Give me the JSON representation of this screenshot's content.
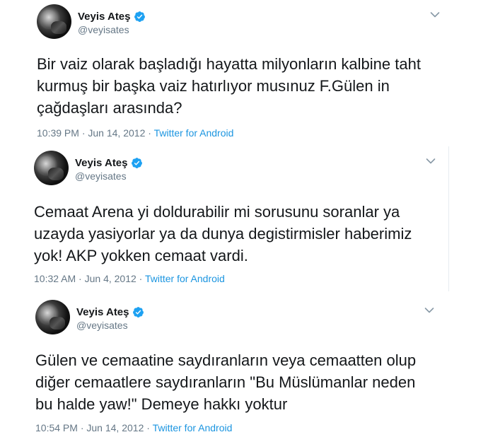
{
  "colors": {
    "verified": "#1da1f2",
    "link": "#1b95e0",
    "muted": "#657786",
    "text": "#14171a"
  },
  "tweets": [
    {
      "display_name": "Veyis Ateş",
      "handle": "@veyisates",
      "text": "Bir vaiz olarak başladığı hayatta milyonların kalbine taht\nkurmuş bir başka vaiz hatırlıyor musınuz F.Gülen in\nçağdaşları arasında?",
      "time": "10:39 PM",
      "separator": " · ",
      "date": "Jun 14, 2012",
      "source": "Twitter for Android"
    },
    {
      "display_name": "Veyis Ateş",
      "handle": "@veyisates",
      "text": "Cemaat Arena yi doldurabilir mi sorusunu soranlar ya\nuzayda yasiyorlar ya da  dunya degistirmisler haberimiz\nyok! AKP yokken cemaat vardi.",
      "time": "10:32 AM",
      "separator": " · ",
      "date": "Jun 4, 2012",
      "source": "Twitter for Android"
    },
    {
      "display_name": "Veyis Ateş",
      "handle": "@veyisates",
      "text": "Gülen ve cemaatine saydıranların veya cemaatten olup\ndiğer cemaatlere saydıranların \"Bu Müslümanlar neden\nbu halde yaw!\" Demeye hakkı yoktur",
      "time": "10:54 PM",
      "separator": " · ",
      "date": "Jun 14, 2012",
      "source": "Twitter for Android"
    }
  ]
}
